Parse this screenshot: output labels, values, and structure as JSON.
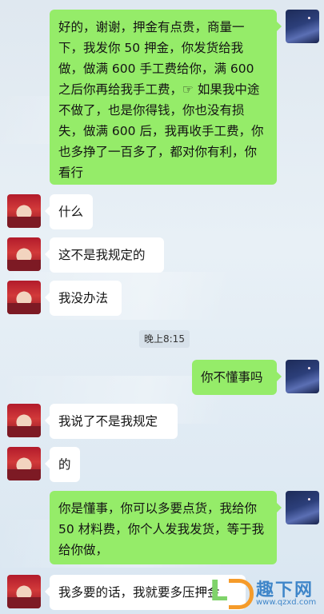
{
  "chat": {
    "messages": [
      {
        "text": "好的，谢谢，押金有点贵，商量一下，我发你 50 押金，你发货给我做，做满 600 手工费给你，满 600 之后你再给我手工费，☞ 如果我中途不做了，也是你得钱，你也没有损失，做满 600 后，我再收手工费，你也多挣了一百多了，都对你有利，你看行"
      },
      {
        "text": "什么"
      },
      {
        "text": "这不是我规定的"
      },
      {
        "text": "我没办法"
      },
      {
        "text": "你不懂事吗"
      },
      {
        "text": "我说了不是我规定"
      },
      {
        "text": "的"
      },
      {
        "text": "你是懂事，你可以多要点货，我给你 50 材料费，你个人发我发货，等于我给你做，"
      },
      {
        "text": "我多要的话，我就要多压押金"
      }
    ],
    "timestamp": "晚上8:15"
  },
  "watermark": {
    "brand": "趣下网",
    "url": "www.qzxd.com",
    "logo_letter": "L"
  },
  "colors": {
    "bubble_out": "#95ec69",
    "bubble_in": "#ffffff"
  }
}
